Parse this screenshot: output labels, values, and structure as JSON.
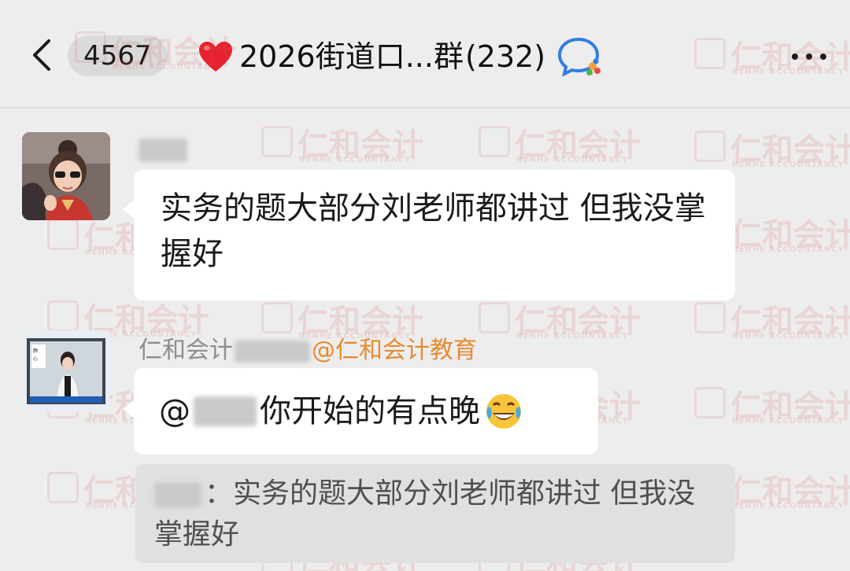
{
  "header": {
    "unread_count": "4567",
    "title": "2026街道口...群",
    "member_count": "(232)"
  },
  "messages": [
    {
      "sender_name_blurred": "肖雷",
      "text": "实务的题大部分刘老师都讲过  但我没掌握好"
    },
    {
      "sender_prefix": "仁和会计",
      "sender_suffix": "@仁和会计教育",
      "mention_prefix": "@",
      "text": "你开始的有点晚",
      "quote_text": "：实务的题大部分刘老师都讲过  但我没掌握好"
    }
  ],
  "watermark": {
    "brand": "仁和会计",
    "sub": "RENHE ACCOUNTANCY"
  },
  "colors": {
    "background": "#ededed",
    "bubble": "#ffffff",
    "quote_bg": "#e0e0e0",
    "mention_orange": "#e88a2e",
    "sender_gray": "#8d8d8d"
  },
  "icons": [
    "back-arrow-icon",
    "heart-icon",
    "chat-app-icon",
    "more-icon",
    "cry-laugh-emoji-icon"
  ]
}
